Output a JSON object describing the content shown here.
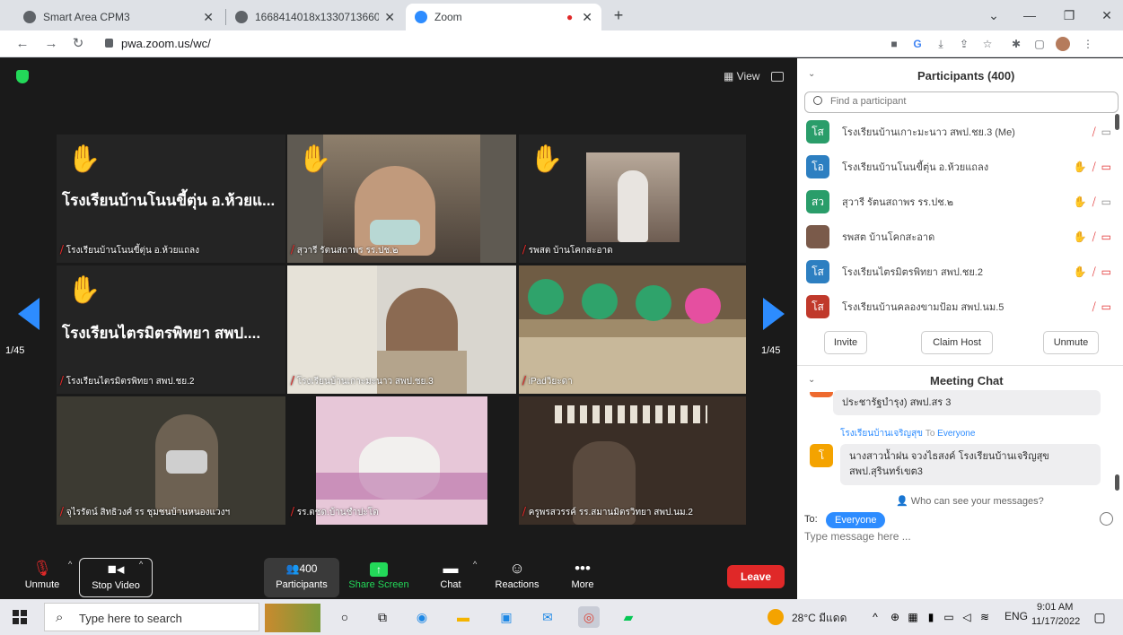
{
  "browser": {
    "tabs": [
      {
        "title": "Smart Area CPM3",
        "favicon_color": "#5f6368"
      },
      {
        "title": "1668414018x1330713660_2.jpg (",
        "favicon_color": "#5f6368"
      },
      {
        "title": "Zoom",
        "favicon_color": "#2d8cff"
      }
    ],
    "new_tab": "+",
    "url": "pwa.zoom.us/wc/"
  },
  "meeting": {
    "view_label": "▦ View",
    "page_indicator_left": "1/45",
    "page_indicator_right": "1/45",
    "tiles": [
      {
        "name": "โรงเรียนบ้านโนนขี้ตุ่น อ.ห้วยแถลง",
        "big_name": "โรงเรียนบ้านโนนขี้ตุ่น อ.ห้วยแ...",
        "hand": true
      },
      {
        "name": "สุวารี รัตนสถาพร รร.ปช.๒",
        "hand": true
      },
      {
        "name": "รพสต บ้านโคกสะอาด",
        "hand": true
      },
      {
        "name": "โรงเรียนไตรมิตรพิทยา สพป.ชย.2",
        "big_name": "โรงเรียนไตรมิตรพิทยา สพป....",
        "hand": true
      },
      {
        "name": "โรงเรียนบ้านเกาะมะนาว สพป.ชย.3",
        "hand": false
      },
      {
        "name": "iPadวิยะดา",
        "hand": false
      },
      {
        "name": "จุไรรัตน์ สิทธิวงศ์ รร ชุมชนบ้านหนองแวงฯ",
        "hand": false
      },
      {
        "name": "รร.ตชด.บ้านชำปะโต",
        "hand": false
      },
      {
        "name": "ครูพรสวรรค์ รร.สมานมิตรวิทยา สพป.นม.2",
        "hand": false
      }
    ]
  },
  "toolbar": {
    "unmute": "Unmute",
    "stop_video": "Stop Video",
    "participants_count": "400",
    "participants": "Participants",
    "share_screen": "Share Screen",
    "chat": "Chat",
    "reactions": "Reactions",
    "more": "More",
    "leave": "Leave",
    "share_color": "#23d959",
    "leave_color": "#e02828"
  },
  "participants_panel": {
    "title": "Participants (400)",
    "search_placeholder": "Find a participant",
    "rows": [
      {
        "avatar": "โส",
        "color": "#2a9d6a",
        "name": "โรงเรียนบ้านเกาะมะนาว สพป.ชย.3 (Me)",
        "hand": false,
        "video_off": false
      },
      {
        "avatar": "โอ",
        "color": "#2d7fc1",
        "name": "โรงเรียนบ้านโนนขี้ตุ่น อ.ห้วยแถลง",
        "hand": true,
        "video_off": true
      },
      {
        "avatar": "สว",
        "color": "#2a9d6a",
        "name": "สุวารี รัตนสถาพร รร.ปช.๒",
        "hand": true,
        "video_off": false
      },
      {
        "avatar": "",
        "color": "#7a5a4a",
        "name": "รพสต บ้านโคกสะอาด",
        "hand": true,
        "video_off": true
      },
      {
        "avatar": "โส",
        "color": "#2d7fc1",
        "name": "โรงเรียนไตรมิตรพิทยา สพป.ชย.2",
        "hand": true,
        "video_off": true
      },
      {
        "avatar": "โส",
        "color": "#c0392b",
        "name": "โรงเรียนบ้านคลองขามป้อม สพป.นม.5",
        "hand": false,
        "video_off": true
      }
    ],
    "invite": "Invite",
    "claim_host": "Claim Host",
    "unmute_all": "Unmute"
  },
  "chat_panel": {
    "title": "Meeting Chat",
    "prev_message": "ประชารัฐบำรุง) สพป.สร 3",
    "sender": "โรงเรียนบ้านเจริญสุข",
    "to_label": "To",
    "to_target": "Everyone",
    "sender_avatar": "โ",
    "message": "นางสาวน้ำฝน จวงไธสงค์ โรงเรียนบ้านเจริญสุข สพป.สุรินทร์เขต3",
    "who_can_see": "Who can see your messages?",
    "to_prefix": "To:",
    "recipient": "Everyone",
    "input_placeholder": "Type message here ..."
  },
  "taskbar": {
    "search_placeholder": "Type here to search",
    "weather": "28°C มีแดด",
    "lang": "ENG",
    "time": "9:01 AM",
    "date": "11/17/2022"
  }
}
